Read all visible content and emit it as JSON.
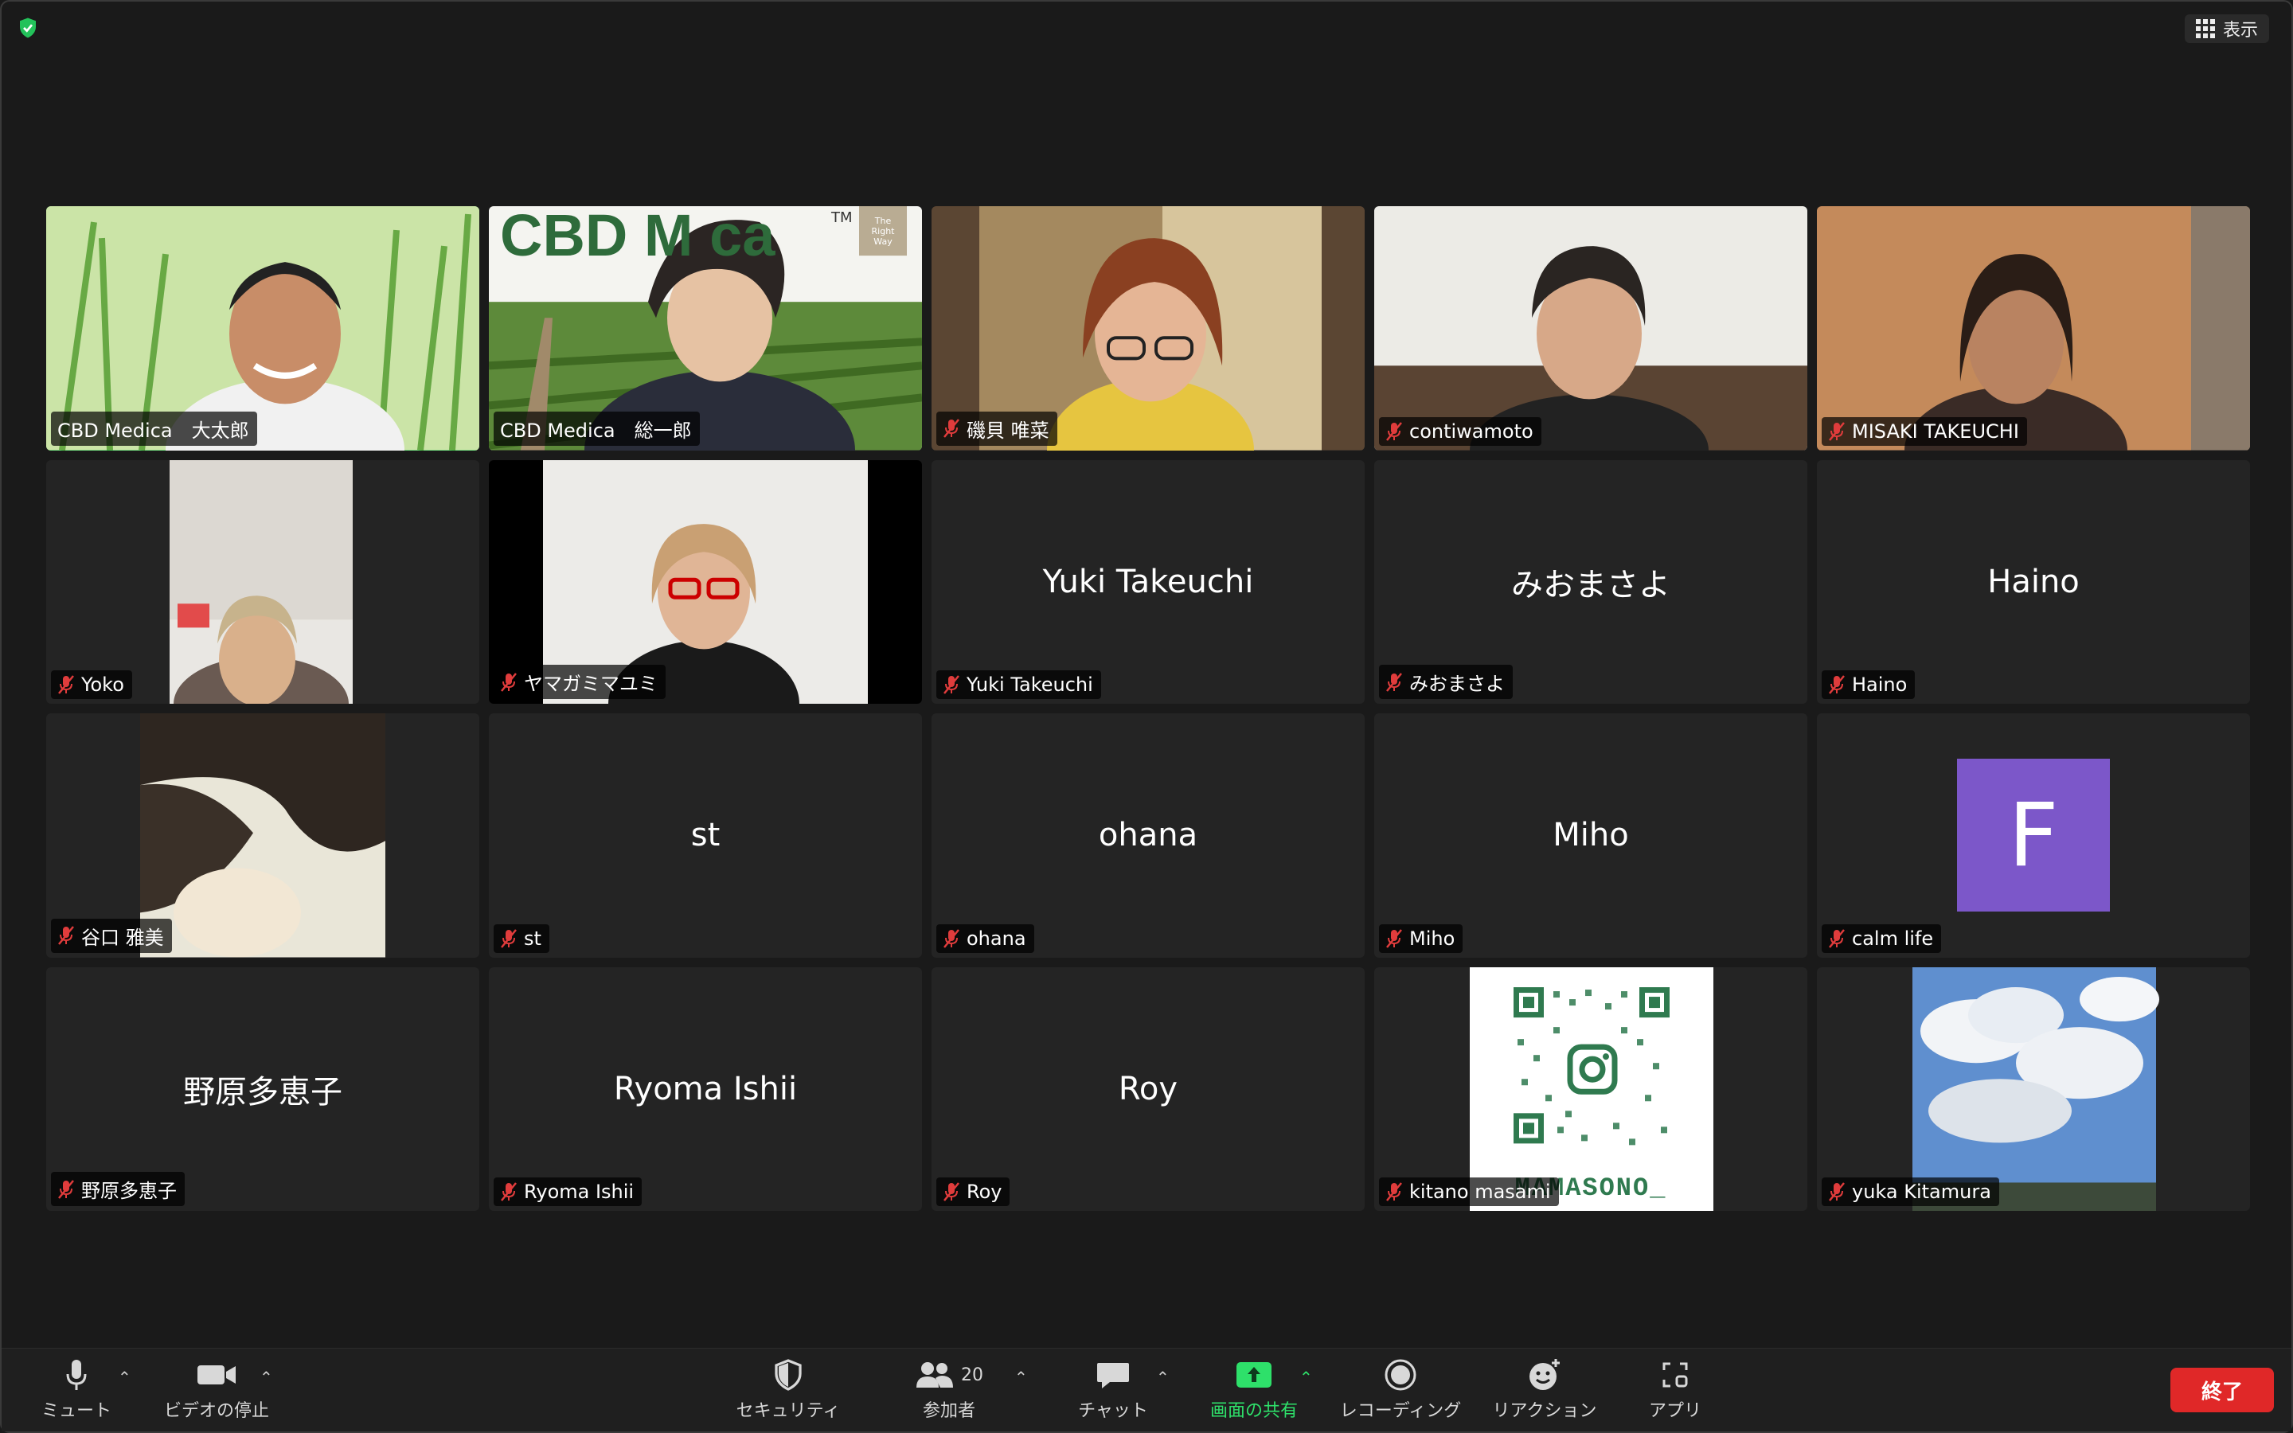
{
  "header": {
    "view_label": "表示"
  },
  "participants": [
    {
      "name": "CBD Medica　大太郎",
      "muted": false,
      "video": "green-grass"
    },
    {
      "name": "CBD Medica　総一郎",
      "muted": false,
      "video": "cbd-banner",
      "banner_text": "CBD M   ca",
      "banner_tm": "TM",
      "banner_tag": "The Right Way"
    },
    {
      "name": "磯貝 唯菜",
      "muted": true,
      "video": "room"
    },
    {
      "name": "contiwamoto",
      "muted": true,
      "video": "room-light"
    },
    {
      "name": "MISAKI TAKEUCHI",
      "muted": true,
      "video": "room-warm"
    },
    {
      "name": "Yoko",
      "muted": true,
      "video": "portrait-small"
    },
    {
      "name": "ヤマガミマユミ",
      "muted": true,
      "video": "portrait-white"
    },
    {
      "name": "Yuki Takeuchi",
      "muted": true,
      "center": "Yuki Takeuchi"
    },
    {
      "name": "みおまさよ",
      "muted": true,
      "center": "みおまさよ"
    },
    {
      "name": "Haino",
      "muted": true,
      "center": "Haino"
    },
    {
      "name": "谷口 雅美",
      "muted": true,
      "video": "hair-closeup"
    },
    {
      "name": "st",
      "muted": true,
      "center": "st"
    },
    {
      "name": "ohana",
      "muted": true,
      "center": "ohana"
    },
    {
      "name": "Miho",
      "muted": true,
      "center": "Miho"
    },
    {
      "name": "calm life",
      "muted": true,
      "avatar_letter": "F"
    },
    {
      "name": "野原多恵子",
      "muted": true,
      "center": "野原多恵子"
    },
    {
      "name": "Ryoma Ishii",
      "muted": true,
      "center": "Ryoma Ishii"
    },
    {
      "name": "Roy",
      "muted": true,
      "center": "Roy"
    },
    {
      "name": "kitano masami",
      "muted": true,
      "video": "qr-code",
      "qr_caption": "MAMASONO_"
    },
    {
      "name": "yuka Kitamura",
      "muted": true,
      "video": "sky"
    }
  ],
  "toolbar": {
    "mute": "ミュート",
    "video_stop": "ビデオの停止",
    "security": "セキュリティ",
    "participants": "参加者",
    "participants_count": "20",
    "chat": "チャット",
    "share": "画面の共有",
    "record": "レコーディング",
    "reactions": "リアクション",
    "apps": "アプリ",
    "end": "終了"
  },
  "colors": {
    "active_speaker": "#23d959",
    "end_button": "#e02828",
    "share_green": "#2ee06a",
    "avatar_purple": "#7c57c9",
    "muted_red": "#e03c3c"
  }
}
